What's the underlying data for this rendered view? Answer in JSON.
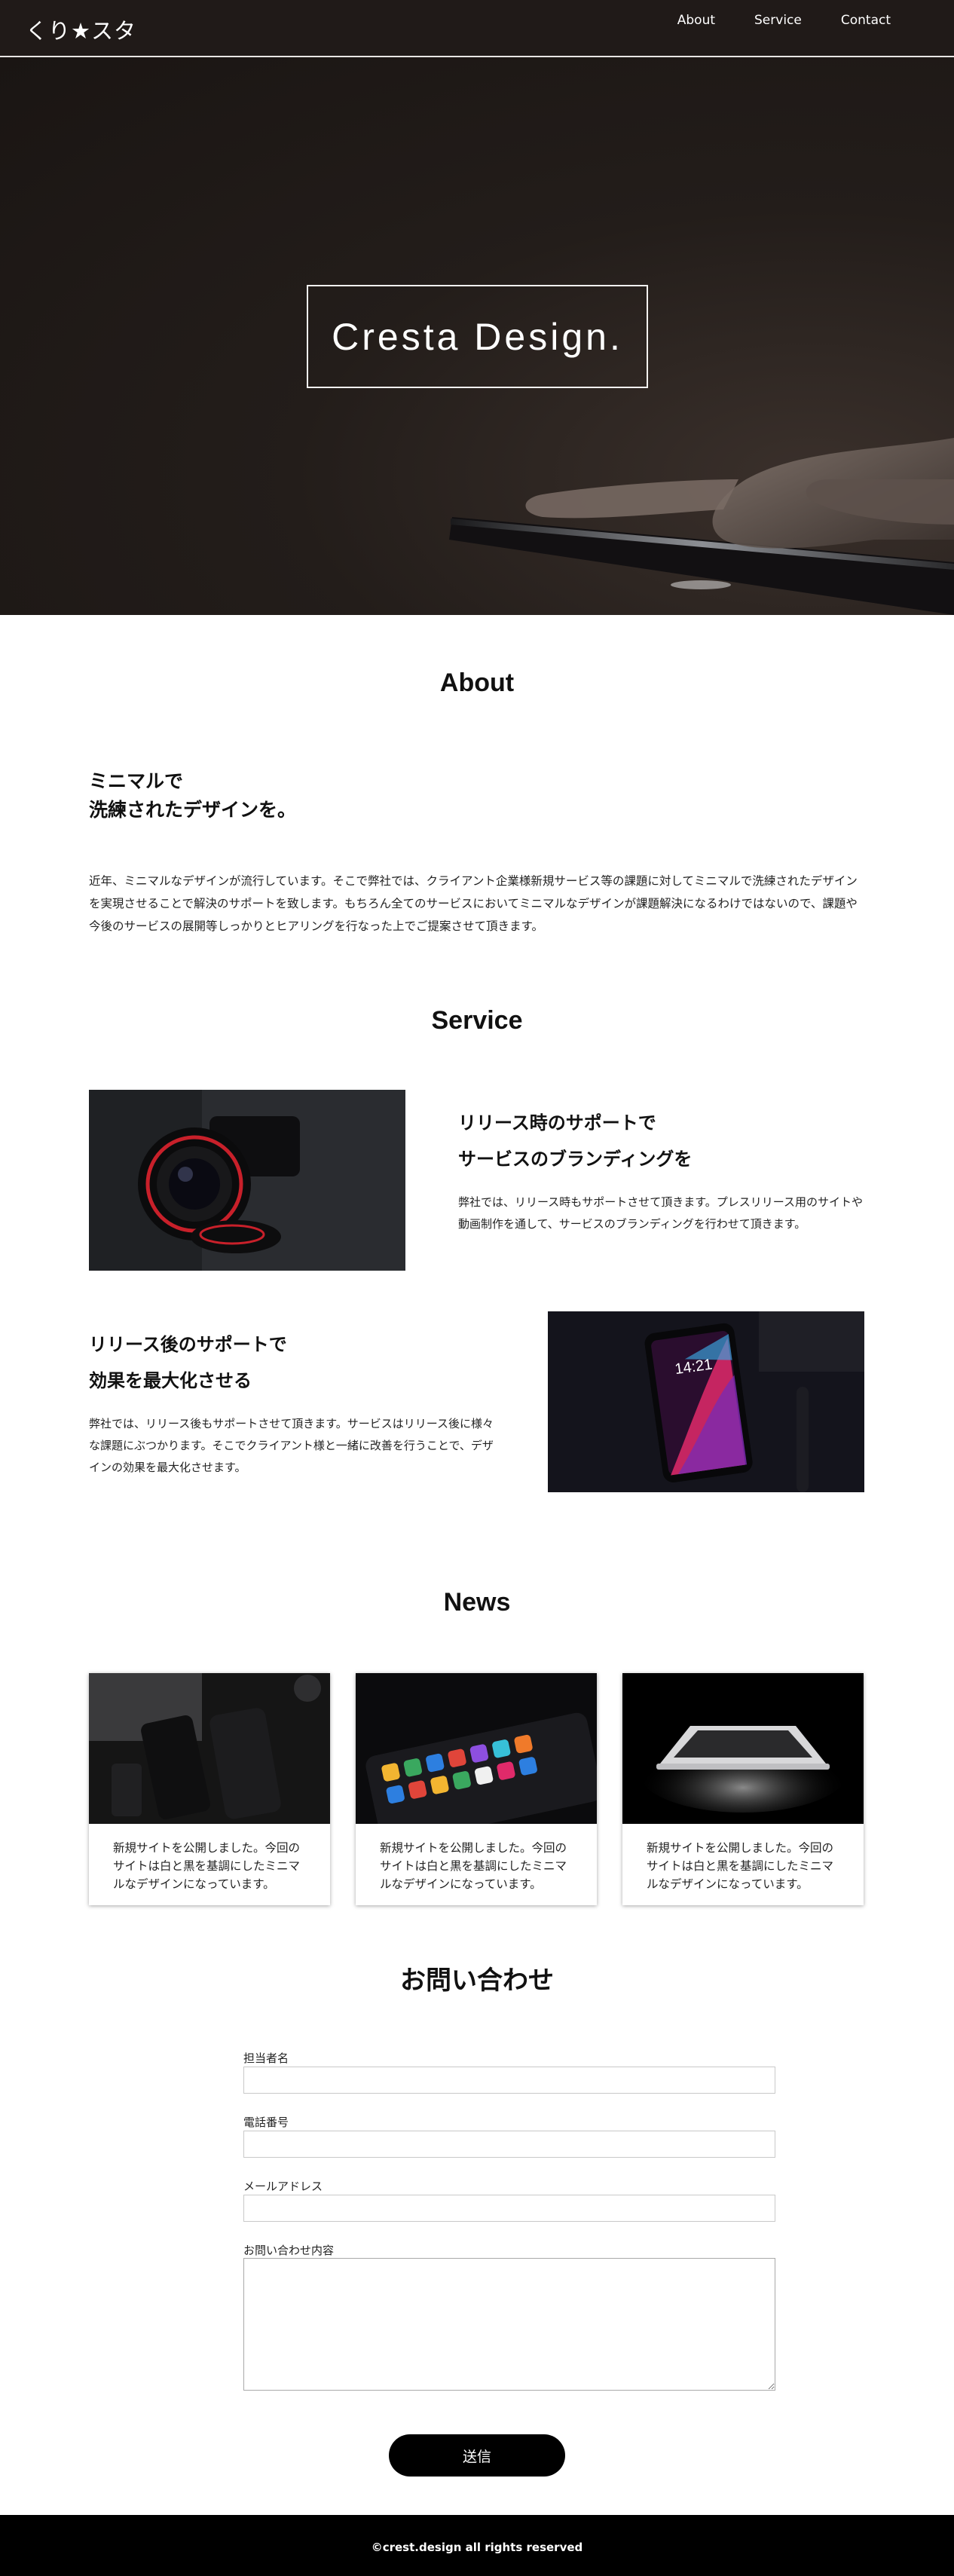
{
  "header": {
    "logo": "くり★スタ",
    "nav": [
      "About",
      "Service",
      "Contact"
    ]
  },
  "hero": {
    "title": "Cresta Design."
  },
  "about": {
    "title": "About",
    "heading_line1": "ミニマルで",
    "heading_line2": "洗練されたデザインを。",
    "text": "近年、ミニマルなデザインが流行しています。そこで弊社では、クライアント企業様新規サービス等の課題に対してミニマルで洗練されたデザインを実現させることで解決のサポートを致します。もちろん全てのサービスにおいてミニマルなデザインが課題解決になるわけではないので、課題や今後のサービスの展開等しっかりとヒアリングを行なった上でご提案させて頂きます。"
  },
  "service": {
    "title": "Service",
    "items": [
      {
        "heading_line1": "リリース時のサポートで",
        "heading_line2": "サービスのブランディングを",
        "text": "弊社では、リリース時もサポートさせて頂きます。プレスリリース用のサイトや動画制作を通して、サービスのブランディングを行わせて頂きます。",
        "image_icon": "camera-photo-icon"
      },
      {
        "heading_line1": "リリース後のサポートで",
        "heading_line2": "効果を最大化させる",
        "text": "弊社では、リリース後もサポートさせて頂きます。サービスはリリース後に様々な課題にぶつかります。そこでクライアント様と一緒に改善を行うことで、デザインの効果を最大化させます。",
        "image_icon": "smartphone-photo-icon",
        "phone_time": "14:21"
      }
    ]
  },
  "news": {
    "title": "News",
    "items": [
      {
        "text": "新規サイトを公開しました。今回のサイトは白と黒を基調にしたミニマルなデザインになっています。"
      },
      {
        "text": "新規サイトを公開しました。今回のサイトは白と黒を基調にしたミニマルなデザインになっています。"
      },
      {
        "text": "新規サイトを公開しました。今回のサイトは白と黒を基調にしたミニマルなデザインになっています。"
      }
    ]
  },
  "contact": {
    "title": "お問い合わせ",
    "fields": [
      {
        "label": "担当者名",
        "value": ""
      },
      {
        "label": "電話番号",
        "value": ""
      },
      {
        "label": "メールアドレス",
        "value": ""
      },
      {
        "label": "お問い合わせ内容",
        "value": ""
      }
    ],
    "submit_label": "送信"
  },
  "footer": {
    "copyright": "©crest.design all rights reserved"
  },
  "colors": {
    "header_bg": "#201a18",
    "footer_bg": "#000000",
    "button_bg": "#000000",
    "accent_red": "#c8202a"
  }
}
